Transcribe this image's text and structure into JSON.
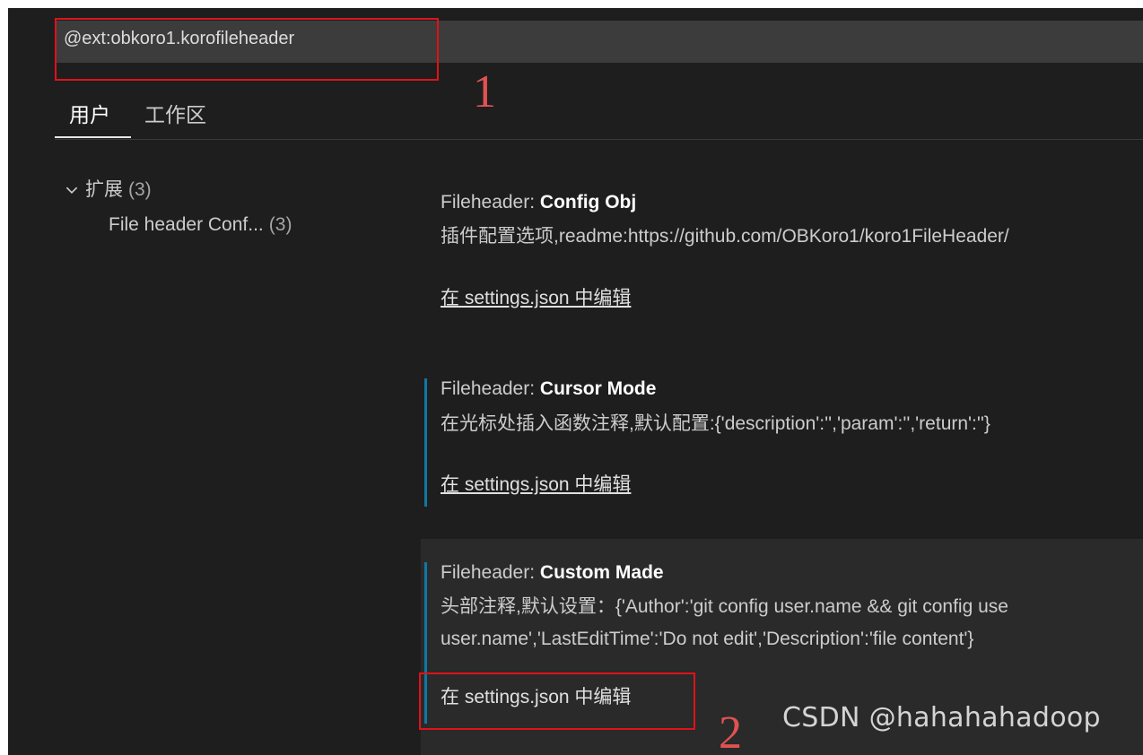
{
  "search": {
    "query": "@ext:obkoro1.korofileheader"
  },
  "tabs": [
    {
      "label": "用户",
      "active": true
    },
    {
      "label": "工作区",
      "active": false
    }
  ],
  "toc": {
    "group_label": "扩展",
    "group_count": "(3)",
    "child_label": "File header Conf...",
    "child_count": "(3)"
  },
  "settings": [
    {
      "category": "Fileheader:",
      "name": "Config Obj",
      "description": "插件配置选项,readme:https://github.com/OBKoro1/koro1FileHeader/",
      "link": "在 settings.json 中编辑"
    },
    {
      "category": "Fileheader:",
      "name": "Cursor Mode",
      "description": "在光标处插入函数注释,默认配置:{'description':'','param':'','return':''}",
      "link": "在 settings.json 中编辑"
    },
    {
      "category": "Fileheader:",
      "name": "Custom Made",
      "description_line1": "头部注释,默认设置：{'Author':'git config user.name && git config use",
      "description_line2": "user.name','LastEditTime':'Do not edit','Description':'file content'}",
      "link": "在 settings.json 中编辑"
    }
  ],
  "annotations": {
    "marker1": "1",
    "marker2": "2",
    "box_color": "#e0121a"
  },
  "watermark": "CSDN @hahahahadoop",
  "colors": {
    "background": "#1e1e1e",
    "accent_bar": "#0e78a3",
    "search_bg": "#3c3c3c"
  }
}
